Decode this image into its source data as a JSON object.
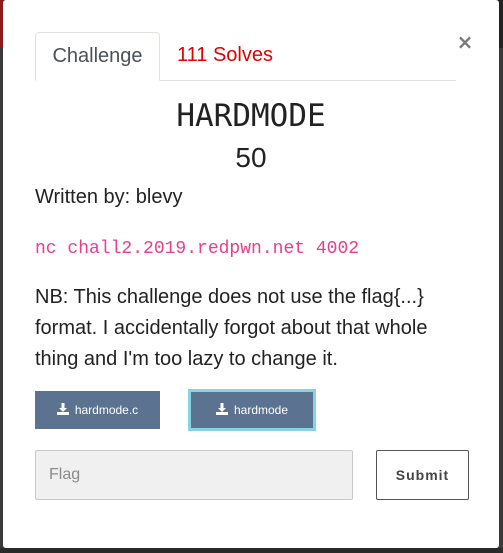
{
  "modal": {
    "close_glyph": "×",
    "tabs": {
      "challenge_label": "Challenge",
      "solves_label": "111 Solves"
    },
    "challenge": {
      "name": "HARDMODE",
      "value": "50",
      "author": "Written by: blevy",
      "connection": "nc chall2.2019.redpwn.net 4002",
      "description": "NB: This challenge does not use the flag{...} format. I accidentally forgot about that whole thing and I'm too lazy to change it."
    },
    "files": [
      {
        "label": "hardmode.c",
        "icon": "download-icon"
      },
      {
        "label": "hardmode",
        "icon": "download-icon"
      }
    ],
    "form": {
      "flag_placeholder": "Flag",
      "flag_value": "",
      "submit_label": "Submit"
    }
  },
  "colors": {
    "solves_red": "#e00000",
    "code_pink": "#e83e8c",
    "file_button": "#5b7290",
    "focus_ring": "#86d4e4"
  }
}
